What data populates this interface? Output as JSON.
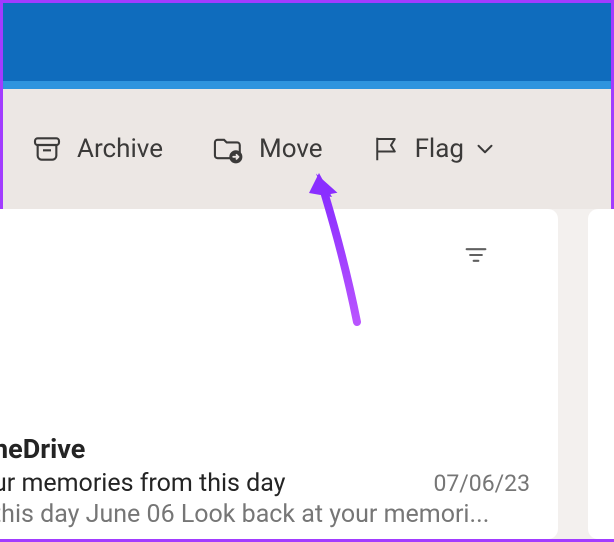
{
  "toolbar": {
    "archive_label": "Archive",
    "move_label": "Move",
    "flag_label": "Flag"
  },
  "email": {
    "sender": "neDrive",
    "subject": "ur memories from this day",
    "date": "07/06/23",
    "preview": " this day June 06 Look back at your memori..."
  }
}
